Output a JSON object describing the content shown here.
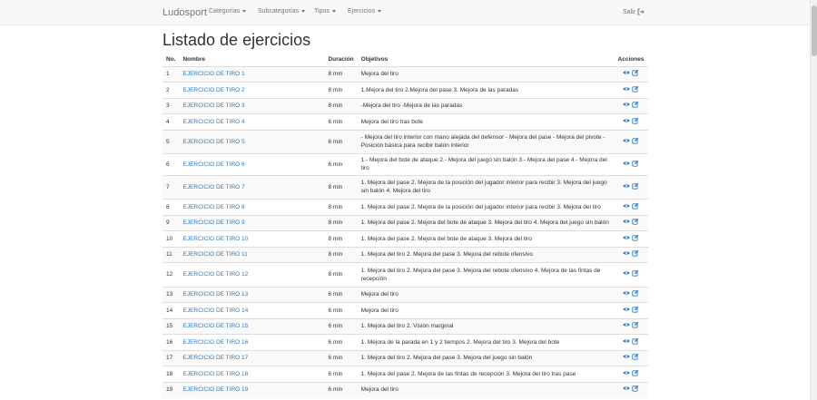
{
  "navbar": {
    "brand": "Ludosport",
    "menus": [
      {
        "label": "Categorías"
      },
      {
        "label": "Subcategorías"
      },
      {
        "label": "Tipos"
      },
      {
        "label": "Ejercicios"
      }
    ],
    "logout": "Salir"
  },
  "page": {
    "title": "Listado de ejercicios"
  },
  "table": {
    "headers": {
      "no": "No.",
      "nombre": "Nombre",
      "duracion": "Duración",
      "objetivos": "Objetivos",
      "acciones": "Acciones"
    },
    "rows": [
      {
        "no": "1",
        "nombre": "EJERCICIO DE TIRO 1",
        "duracion": "8 min",
        "objetivos": "Mejora del tiro"
      },
      {
        "no": "2",
        "nombre": "EJERCICIO DE TIRO 2",
        "duracion": "8 min",
        "objetivos": "1.Mejora del tiro 2.Mejora del pase 3. Mejora de las paradas"
      },
      {
        "no": "3",
        "nombre": "EJERCICIO DE TIRO 3",
        "duracion": "8 min",
        "objetivos": "-Mejora del tiro -Mejora de las paradas"
      },
      {
        "no": "4",
        "nombre": "EJERCICIO DE TIRO 4",
        "duracion": "6 min",
        "objetivos": "Mejora del tiro tras bote"
      },
      {
        "no": "5",
        "nombre": "EJERCICIO DE TIRO 5",
        "duracion": "6 min",
        "objetivos": "- Mejora del tiro interior con mano alejada del defensor - Mejora del pase - Mejora del pivote - Posición básica para recibir balón interior"
      },
      {
        "no": "6",
        "nombre": "EJERCICIO DE TIRO 6",
        "duracion": "6 min",
        "objetivos": "1.- Mejora del bote de ataque 2.- Mejora del juego sin balón 3.- Mejora del pase 4.- Mejora del tiro"
      },
      {
        "no": "7",
        "nombre": "EJERCICIO DE TIRO 7",
        "duracion": "8 min",
        "objetivos": "1. Mejora del pase 2. Mejora de la posición del jugador interior para recibir 3. Mejora del juego sin balón 4. Mejora del tiro"
      },
      {
        "no": "8",
        "nombre": "EJERCICIO DE TIRO 8",
        "duracion": "8 min",
        "objetivos": "1. Mejora del pase 2. Mejora de la posición del jugador interior para recibir 3. Mejora del tiro"
      },
      {
        "no": "9",
        "nombre": "EJERCICIO DE TIRO 9",
        "duracion": "8 min",
        "objetivos": "1. Mejora del pase 2. Mejora del bote de ataque 3. Mejora del tiro 4. Mejora del juego sin balón"
      },
      {
        "no": "10",
        "nombre": "EJERCICIO DE TIRO 10",
        "duracion": "8 min",
        "objetivos": "1. Mejora del pase 2. Mejora del bote de ataque 3. Mejora del tiro"
      },
      {
        "no": "11",
        "nombre": "EJERCICIO DE TIRO 11",
        "duracion": "8 min",
        "objetivos": "1. Mejora del tiro 2. Mejora del pase 3. Mejora del rebote ofensivo"
      },
      {
        "no": "12",
        "nombre": "EJERCICIO DE TIRO 12",
        "duracion": "8 min",
        "objetivos": "1. Mejora del tiro 2. Mejora del pase 3. Mejora del rebote ofensivo 4. Mejora de las fintas de recepción"
      },
      {
        "no": "13",
        "nombre": "EJERCICIO DE TIRO 13",
        "duracion": "6 min",
        "objetivos": "Mejora del tiro"
      },
      {
        "no": "14",
        "nombre": "EJERCICIO DE TIRO 14",
        "duracion": "6 min",
        "objetivos": "Mejora del tiro"
      },
      {
        "no": "15",
        "nombre": "EJERCICIO DE TIRO 15",
        "duracion": "6 min",
        "objetivos": "1. Mejora del tiro 2. Visión marginal"
      },
      {
        "no": "16",
        "nombre": "EJERCICIO DE TIRO 16",
        "duracion": "6 min",
        "objetivos": "1. Mejora de la parada en 1 y 2 tiempos 2. Mejora del tiro 3. Mejora del bote"
      },
      {
        "no": "17",
        "nombre": "EJERCICIO DE TIRO 17",
        "duracion": "6 min",
        "objetivos": "1. Mejora del tiro 2. Mejora del pase 3. Mejora del juego sin balón"
      },
      {
        "no": "18",
        "nombre": "EJERCICIO DE TIRO 18",
        "duracion": "6 min",
        "objetivos": "1. Mejora del pase 2. Mejora de las fintas de recepción 3. Mejora del tiro tras pase"
      },
      {
        "no": "19",
        "nombre": "EJERCICIO DE TIRO 19",
        "duracion": "6 min",
        "objetivos": "Mejora del tiro"
      }
    ]
  },
  "colors": {
    "link": "#337ab7",
    "navbar_bg": "#f8f8f8",
    "border": "#dddddd"
  }
}
